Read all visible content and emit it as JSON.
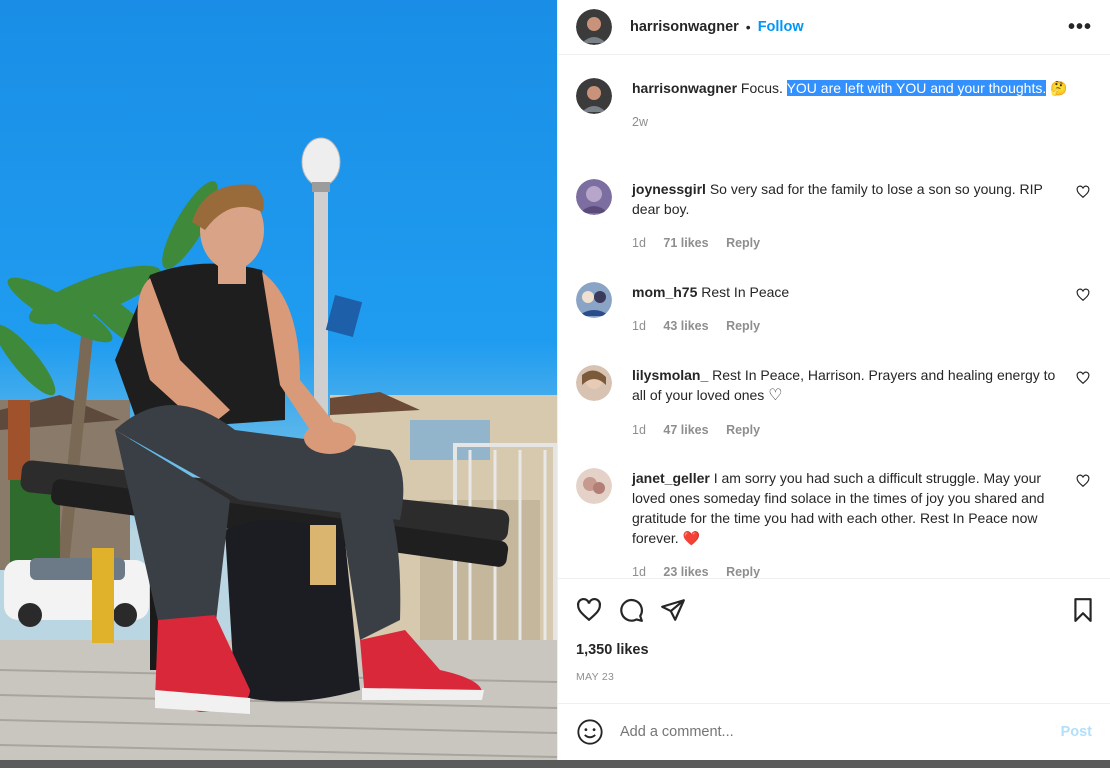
{
  "post": {
    "author": "harrisonwagner",
    "follow_label": "Follow",
    "more_label": "•••",
    "caption_plain": "Focus.",
    "caption_highlight": "YOU are left with YOU and your thoughts.",
    "caption_emoji": "🤔",
    "age": "2w",
    "likes": "1,350 likes",
    "date": "MAY 23"
  },
  "comments": [
    {
      "user": "joynessgirl",
      "text": "So very sad for the family to lose a son so young. RIP dear boy.",
      "age": "1d",
      "likes": "71 likes",
      "reply": "Reply"
    },
    {
      "user": "mom_h75",
      "text": "Rest In Peace",
      "age": "1d",
      "likes": "43 likes",
      "reply": "Reply"
    },
    {
      "user": "lilysmolan_",
      "text": "Rest In Peace, Harrison. Prayers and healing energy to all of your loved ones",
      "emoji": "♡",
      "age": "1d",
      "likes": "47 likes",
      "reply": "Reply"
    },
    {
      "user": "janet_geller",
      "text": "I am sorry you had such a difficult struggle. May your loved ones someday find solace in the times of joy you shared and gratitude for the time you had with each other. Rest In Peace now forever.",
      "emoji": "❤️",
      "age": "1d",
      "likes": "23 likes",
      "reply": "Reply"
    }
  ],
  "composer": {
    "placeholder": "Add a comment...",
    "post_label": "Post"
  },
  "icons": {
    "like": "heart-icon",
    "comment": "comment-icon",
    "share": "paper-plane-icon",
    "save": "bookmark-icon",
    "emoji": "smiley-icon",
    "more": "more-options-icon"
  },
  "colors": {
    "link": "#0095f6",
    "highlight": "#3390ff",
    "muted": "#8e8e8e",
    "post_disabled": "#b2dffc",
    "heart_red": "#ed1c24"
  }
}
